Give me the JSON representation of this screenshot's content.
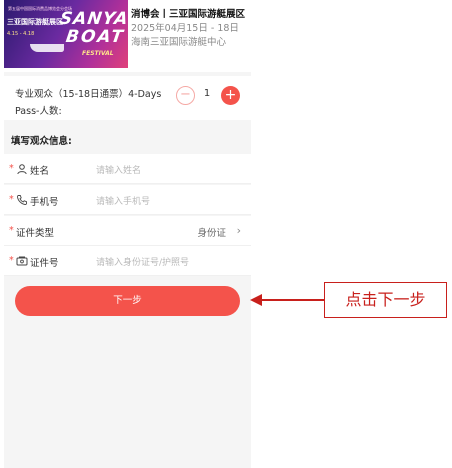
{
  "event": {
    "banner": {
      "small_text": "第五届中国国际消费品博览会分会场",
      "cn_title": "三亚国际游艇展区",
      "date": "4.15 - 4.18",
      "line1": "SANYA",
      "line2": "BOAT",
      "line3": "FESTIVAL"
    },
    "title": "消博会丨三亚国际游艇展区",
    "date": "2025年04月15日 - 18日",
    "venue": "海南三亚国际游艇中心"
  },
  "ticket": {
    "label": "专业观众（15-18日通票）4-Days Pass-人数:",
    "minus": "−",
    "quantity": "1",
    "plus": "+"
  },
  "form": {
    "section_title": "填写观众信息:",
    "required_mark": "*",
    "name": {
      "label": "姓名",
      "placeholder": "请输入姓名",
      "icon": "person-icon"
    },
    "phone": {
      "label": "手机号",
      "placeholder": "请输入手机号",
      "icon": "phone-icon"
    },
    "id_type": {
      "label": "证件类型",
      "value": "身份证",
      "chevron": "›"
    },
    "id_number": {
      "label": "证件号",
      "placeholder": "请输入身份证号/护照号",
      "icon": "id-card-icon"
    }
  },
  "next_button": {
    "label": "下一步"
  },
  "annotation": {
    "text": "点击下一步",
    "color": "#c8201c"
  },
  "colors": {
    "accent": "#f4534b",
    "placeholder": "#b9b9b9"
  }
}
